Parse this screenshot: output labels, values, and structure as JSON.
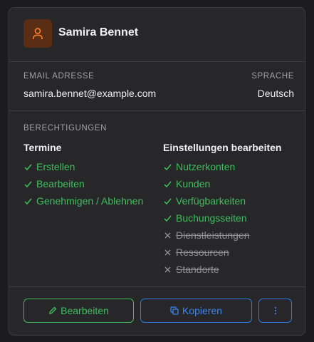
{
  "user": {
    "name": "Samira Bennet"
  },
  "info": {
    "email_label": "EMAIL ADRESSE",
    "email": "samira.bennet@example.com",
    "language_label": "SPRACHE",
    "language": "Deutsch"
  },
  "permissions": {
    "label": "BERECHTIGUNGEN",
    "appointments": {
      "title": "Termine",
      "items": [
        {
          "label": "Erstellen",
          "enabled": true
        },
        {
          "label": "Bearbeiten",
          "enabled": true
        },
        {
          "label": "Genehmigen / Ablehnen",
          "enabled": true
        }
      ]
    },
    "settings": {
      "title": "Einstellungen bearbeiten",
      "items": [
        {
          "label": "Nutzerkonten",
          "enabled": true
        },
        {
          "label": "Kunden",
          "enabled": true
        },
        {
          "label": "Verfügbarkeiten",
          "enabled": true
        },
        {
          "label": "Buchungsseiten",
          "enabled": true
        },
        {
          "label": "Dienstleistungen",
          "enabled": false
        },
        {
          "label": "Ressourcen",
          "enabled": false
        },
        {
          "label": "Standorte",
          "enabled": false
        }
      ]
    }
  },
  "actions": {
    "edit_label": "Bearbeiten",
    "copy_label": "Kopieren"
  },
  "colors": {
    "accent_green": "#3fbf5c",
    "accent_blue": "#3a86f0",
    "avatar_orange": "#f07a2a"
  }
}
